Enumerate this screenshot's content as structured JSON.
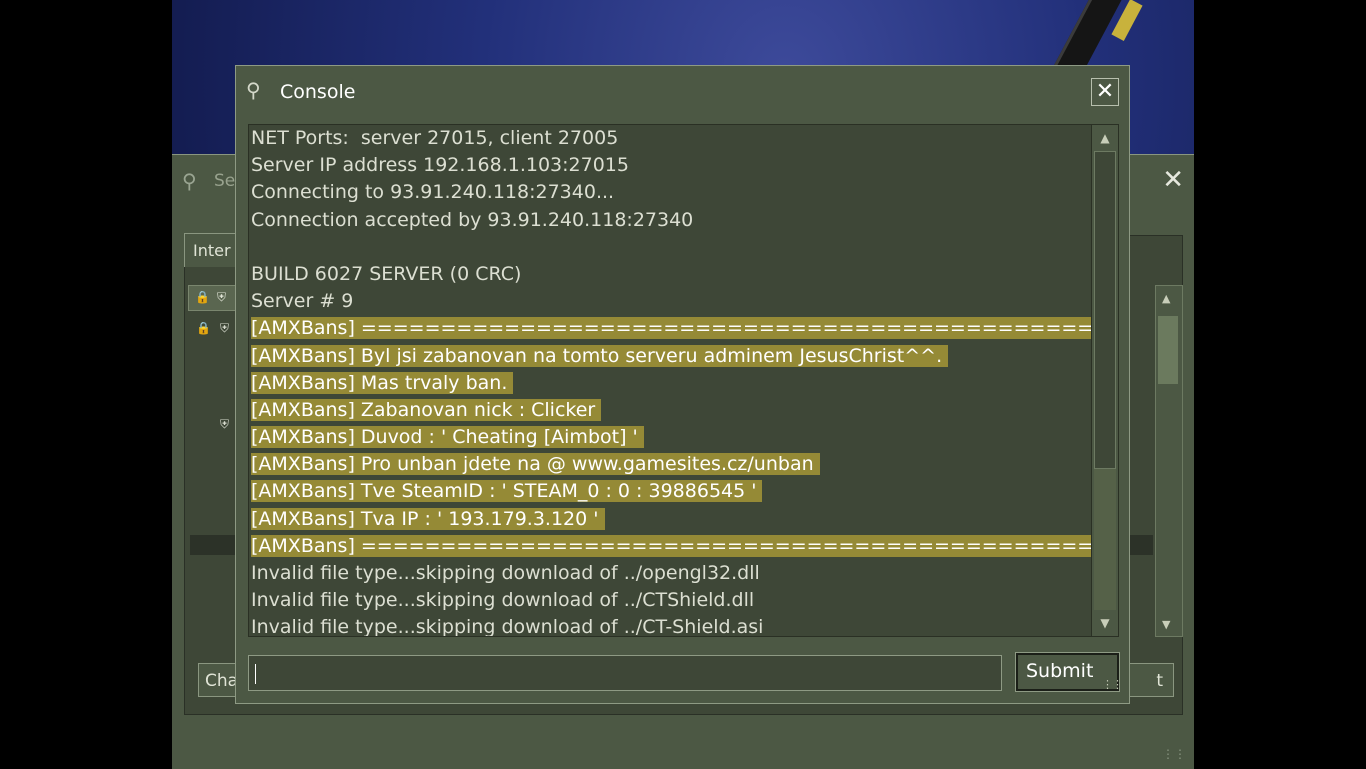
{
  "background": {
    "art": "counter-strike-menu-art"
  },
  "servers_window": {
    "title": "Se",
    "close_icon": "close-icon",
    "tab_label": "Inter",
    "left_button_label": "Cha",
    "right_button_label": "t"
  },
  "console": {
    "title": "Console",
    "icon": "steam-icon",
    "close_icon": "close-icon",
    "input": {
      "value": "",
      "placeholder": ""
    },
    "submit_label": "Submit",
    "highlight_color": "#958a36",
    "lines": [
      {
        "text": "NET Ports:  server 27015, client 27005",
        "highlight": false
      },
      {
        "text": "Server IP address 192.168.1.103:27015",
        "highlight": false
      },
      {
        "text": "Connecting to 93.91.240.118:27340...",
        "highlight": false
      },
      {
        "text": "Connection accepted by 93.91.240.118:27340",
        "highlight": false
      },
      {
        "text": "",
        "highlight": false
      },
      {
        "text": "BUILD 6027 SERVER (0 CRC)",
        "highlight": false
      },
      {
        "text": "Server # 9",
        "highlight": false
      },
      {
        "text": "[AMXBans] ================================================",
        "highlight": true
      },
      {
        "text": "[AMXBans] Byl jsi zabanovan na tomto serveru adminem JesusChrist^^.",
        "highlight": true
      },
      {
        "text": "[AMXBans] Mas trvaly ban.",
        "highlight": true
      },
      {
        "text": "[AMXBans] Zabanovan nick : Clicker",
        "highlight": true
      },
      {
        "text": "[AMXBans] Duvod : ' Cheating [Aimbot] '",
        "highlight": true
      },
      {
        "text": "[AMXBans] Pro unban jdete na @ www.gamesites.cz/unban",
        "highlight": true
      },
      {
        "text": "[AMXBans] Tve SteamID : ' STEAM_0 : 0 : 39886545 '",
        "highlight": true
      },
      {
        "text": "[AMXBans] Tva IP : ' 193.179.3.120 '",
        "highlight": true
      },
      {
        "text": "[AMXBans] ================================================",
        "highlight": true
      },
      {
        "text": "Invalid file type...skipping download of ../opengl32.dll",
        "highlight": false
      },
      {
        "text": "Invalid file type...skipping download of ../CTShield.dll",
        "highlight": false
      },
      {
        "text": "Invalid file type...skipping download of ../CT-Shield.asi",
        "highlight": false
      }
    ]
  }
}
